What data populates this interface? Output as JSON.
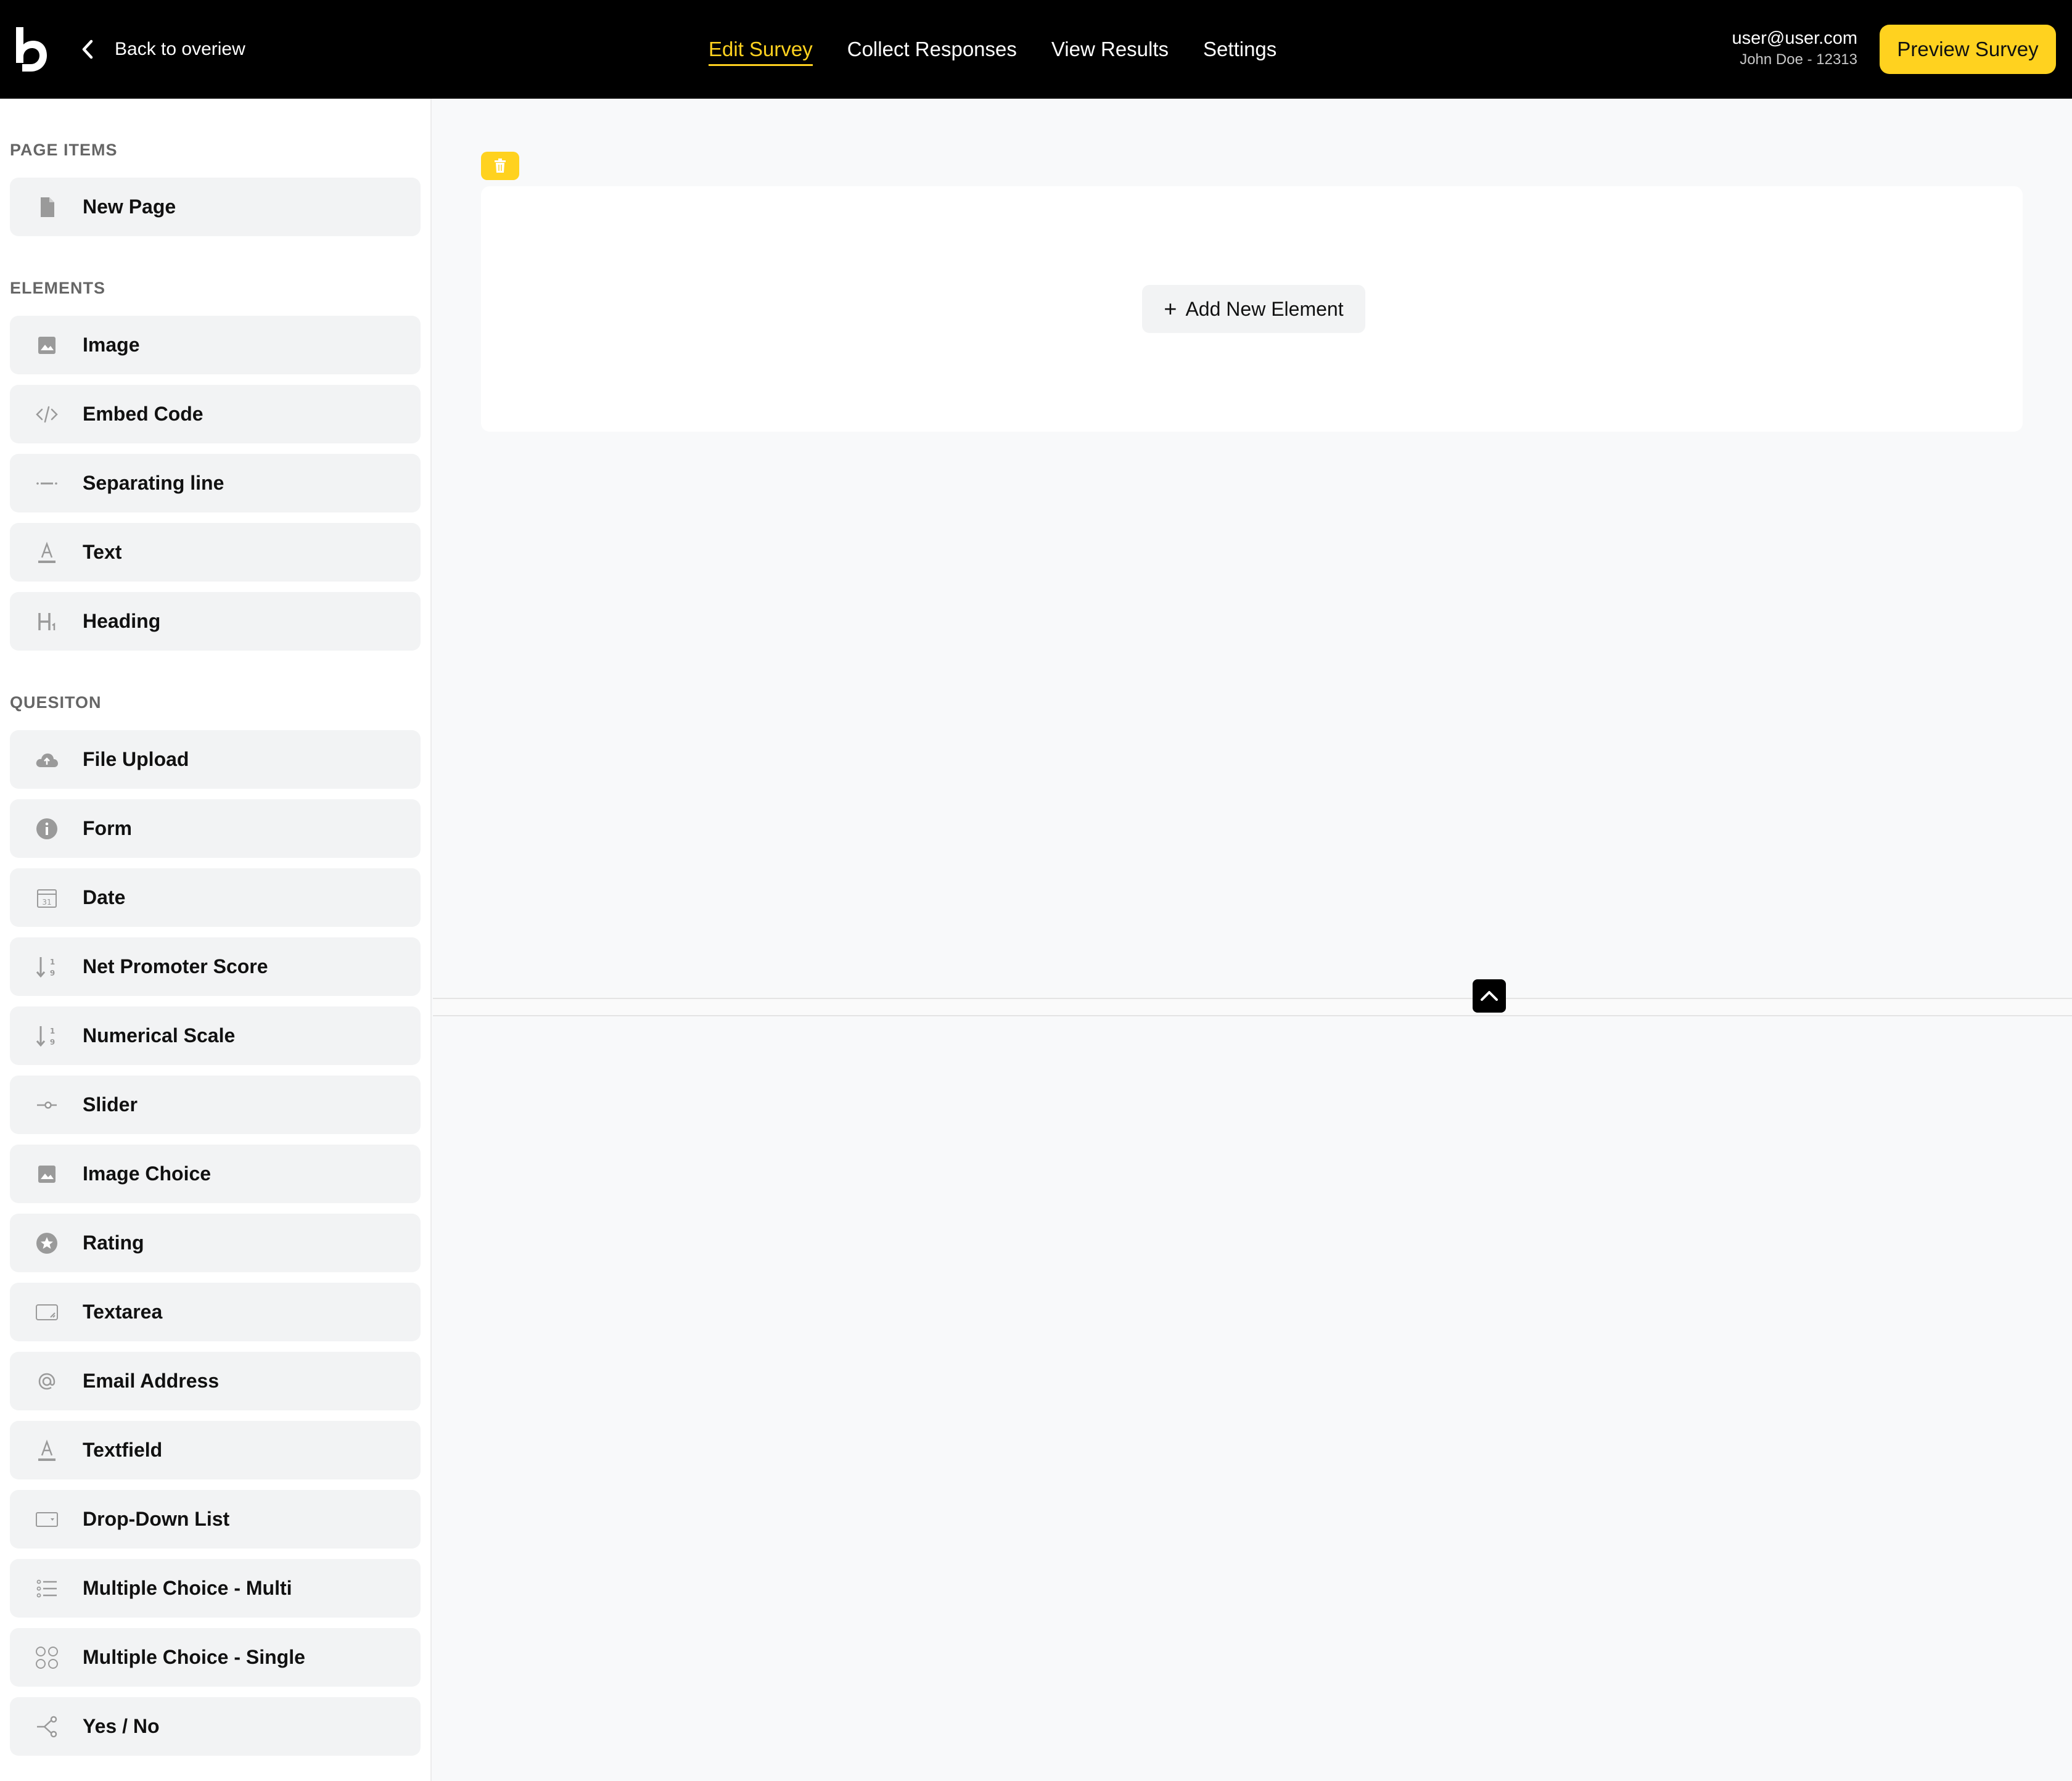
{
  "header": {
    "back_label": "Back to overiew",
    "nav": [
      {
        "label": "Edit Survey",
        "active": true
      },
      {
        "label": "Collect Responses",
        "active": false
      },
      {
        "label": "View Results",
        "active": false
      },
      {
        "label": "Settings",
        "active": false
      }
    ],
    "user_email": "user@user.com",
    "user_name": "John Doe - 12313",
    "preview_label": "Preview Survey"
  },
  "sidebar": {
    "page_items_label": "PAGE ITEMS",
    "page_items": [
      {
        "label": "New Page",
        "icon": "page-icon"
      }
    ],
    "elements_label": "ELEMENTS",
    "elements": [
      {
        "label": "Image",
        "icon": "image-icon"
      },
      {
        "label": "Embed Code",
        "icon": "code-icon"
      },
      {
        "label": "Separating line",
        "icon": "separator-icon"
      },
      {
        "label": "Text",
        "icon": "text-icon"
      },
      {
        "label": "Heading",
        "icon": "heading-icon"
      }
    ],
    "question_label": "QUESITON",
    "questions": [
      {
        "label": "File Upload",
        "icon": "cloud-upload-icon"
      },
      {
        "label": "Form",
        "icon": "info-icon"
      },
      {
        "label": "Date",
        "icon": "calendar-icon"
      },
      {
        "label": "Net Promoter Score",
        "icon": "sort-numeric-icon"
      },
      {
        "label": "Numerical Scale",
        "icon": "sort-numeric-icon"
      },
      {
        "label": "Slider",
        "icon": "slider-icon"
      },
      {
        "label": "Image Choice",
        "icon": "image-icon"
      },
      {
        "label": "Rating",
        "icon": "star-icon"
      },
      {
        "label": "Textarea",
        "icon": "textarea-icon"
      },
      {
        "label": "Email Address",
        "icon": "at-icon"
      },
      {
        "label": "Textfield",
        "icon": "text-icon"
      },
      {
        "label": "Drop-Down List",
        "icon": "dropdown-icon"
      },
      {
        "label": "Multiple Choice - Multi",
        "icon": "list-icon"
      },
      {
        "label": "Multiple Choice - Single",
        "icon": "grid-circles-icon"
      },
      {
        "label": "Yes / No",
        "icon": "branch-icon"
      }
    ]
  },
  "canvas": {
    "add_element_label": "Add New Element",
    "add_symbol": "+"
  },
  "colors": {
    "accent": "#ffd21f",
    "header_bg": "#000000",
    "item_bg": "#f2f3f4"
  }
}
